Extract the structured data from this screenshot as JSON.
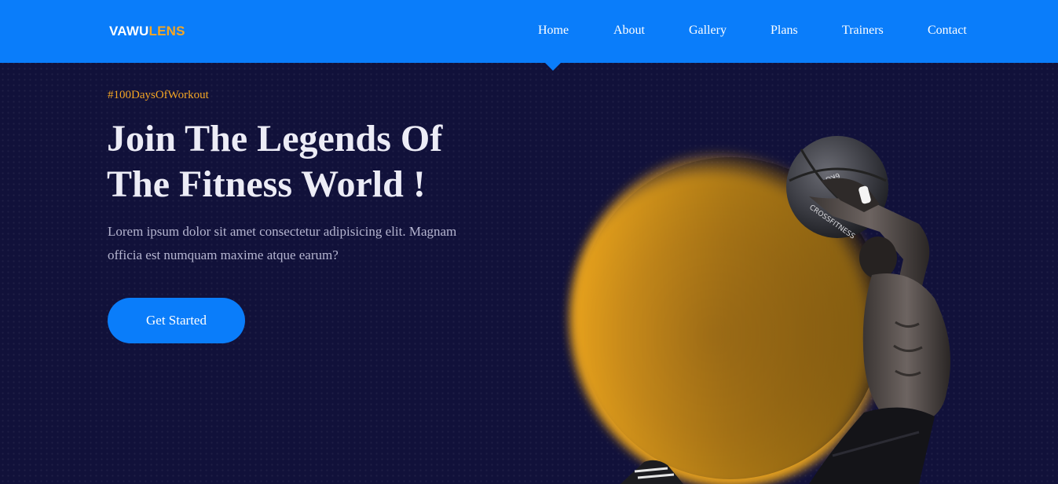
{
  "brand": {
    "part1": "VAWU",
    "part2": "LENS"
  },
  "nav": {
    "items": [
      {
        "label": "Home",
        "active": true
      },
      {
        "label": "About"
      },
      {
        "label": "Gallery"
      },
      {
        "label": "Plans"
      },
      {
        "label": "Trainers"
      },
      {
        "label": "Contact"
      }
    ]
  },
  "hero": {
    "tagline": "#100DaysOfWorkout",
    "headline_line1": "Join The Legends Of",
    "headline_line2": "The Fitness World !",
    "lead_line1": "Lorem ipsum dolor sit amet consectetur adipisicing elit. Magnam",
    "lead_line2": "officia est numquam maxime atque earum?",
    "cta_label": "Get Started"
  },
  "image": {
    "ball_text_1": "CROSSFITNESS",
    "ball_text_2": "6KG"
  },
  "colors": {
    "primary": "#0a7dfa",
    "accent": "#f5a623",
    "background": "#11113a",
    "heading": "#ececf6",
    "body_text": "#b5b5d0"
  }
}
